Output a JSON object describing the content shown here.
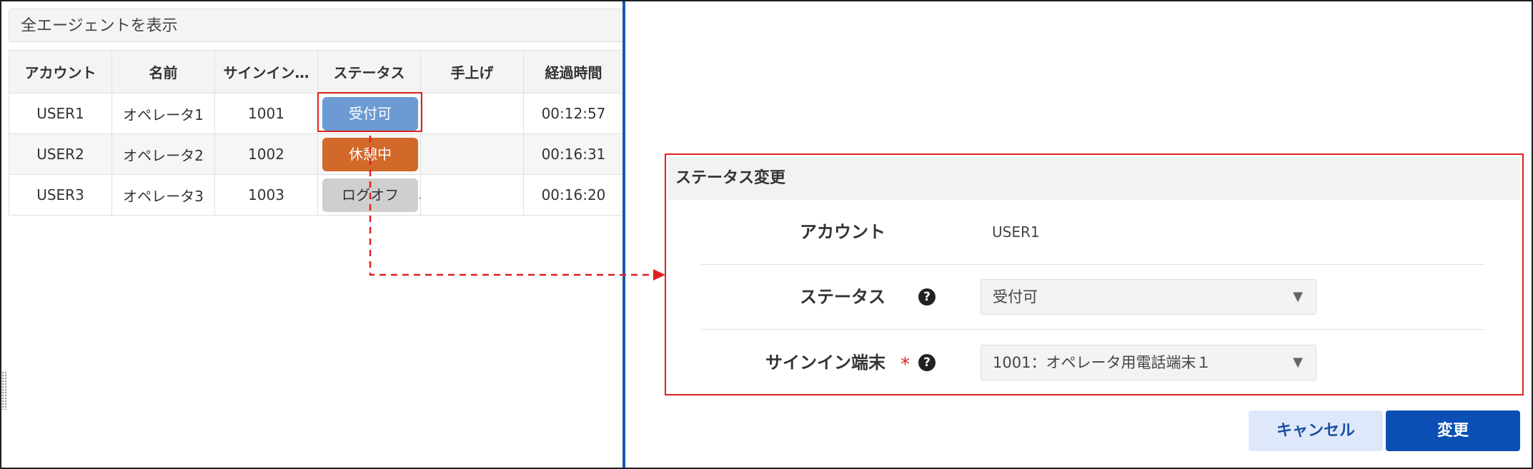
{
  "filter": {
    "label": "全エージェントを表示"
  },
  "table": {
    "columns": [
      "アカウント",
      "名前",
      "サインイン…",
      "ステータス",
      "手上げ",
      "経過時間"
    ],
    "rows": [
      {
        "account": "USER1",
        "name": "オペレータ1",
        "terminal": "1001",
        "status": "受付可",
        "raise": "",
        "elapsed": "00:12:57"
      },
      {
        "account": "USER2",
        "name": "オペレータ2",
        "terminal": "1002",
        "status": "休憩中",
        "raise": "",
        "elapsed": "00:16:31"
      },
      {
        "account": "USER3",
        "name": "オペレータ3",
        "terminal": "1003",
        "status": "ログオフ",
        "raise": "",
        "elapsed": "00:16:20"
      }
    ]
  },
  "colors": {
    "status_available": "#6b9bd2",
    "status_break": "#d2692a",
    "status_logoff": "#cfcfcf",
    "highlight": "#e02020",
    "divider": "#1a56b0",
    "primary_button": "#0b4fb4",
    "secondary_button": "#dfe8fb"
  },
  "dialog": {
    "title": "ステータス変更",
    "account_label": "アカウント",
    "account_value": "USER1",
    "status_label": "ステータス",
    "status_value": "受付可",
    "terminal_label": "サインイン端末",
    "terminal_required_mark": "*",
    "terminal_value": "1001：オペレータ用電話端末１",
    "help_icon_glyph": "?",
    "dropdown_caret": "▼",
    "cancel_label": "キャンセル",
    "change_label": "変更"
  }
}
